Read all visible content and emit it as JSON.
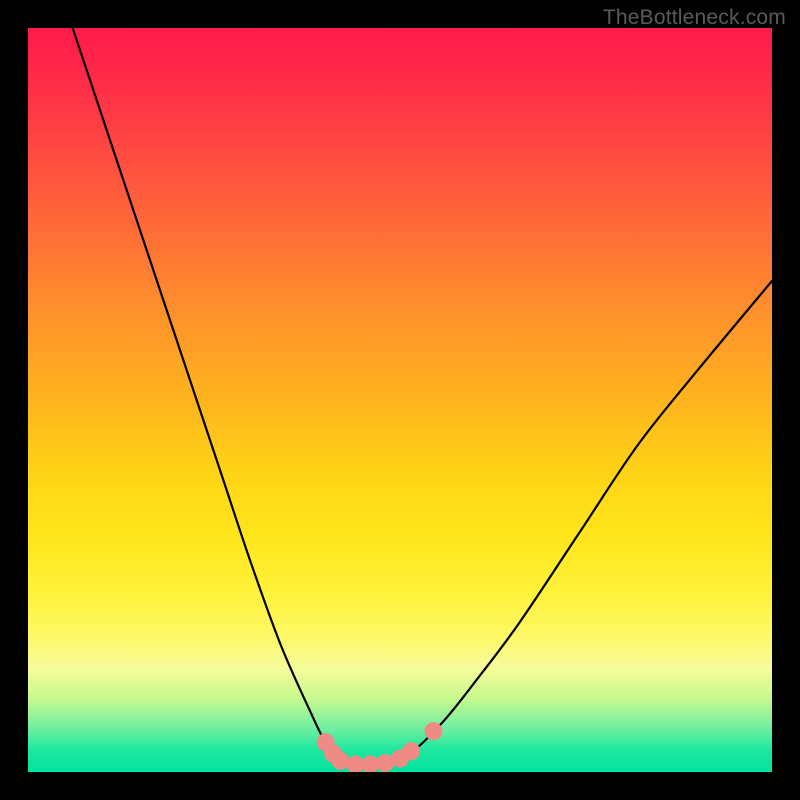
{
  "watermark": "TheBottleneck.com",
  "chart_data": {
    "type": "line",
    "title": "",
    "xlabel": "",
    "ylabel": "",
    "xlim": [
      0,
      100
    ],
    "ylim": [
      0,
      100
    ],
    "grid": false,
    "legend": false,
    "series": [
      {
        "name": "bottleneck-curve",
        "x": [
          6,
          10,
          14,
          18,
          22,
          26,
          30,
          34,
          38,
          40,
          42,
          44,
          46,
          48,
          50,
          52,
          56,
          60,
          66,
          74,
          82,
          90,
          100
        ],
        "y": [
          100,
          88,
          76,
          64,
          52,
          40,
          28,
          17,
          8,
          4,
          2,
          1,
          1,
          1,
          2,
          3,
          7,
          12,
          20,
          32,
          44,
          54,
          66
        ]
      }
    ],
    "markers": [
      {
        "name": "marker-left-top",
        "x": 40.0,
        "y": 4.0
      },
      {
        "name": "marker-left-mid",
        "x": 41.0,
        "y": 2.5
      },
      {
        "name": "marker-left-bot",
        "x": 42.0,
        "y": 1.5
      },
      {
        "name": "marker-flat-1",
        "x": 44.0,
        "y": 1.0
      },
      {
        "name": "marker-flat-2",
        "x": 46.0,
        "y": 1.0
      },
      {
        "name": "marker-flat-3",
        "x": 48.0,
        "y": 1.2
      },
      {
        "name": "marker-flat-4",
        "x": 50.0,
        "y": 1.8
      },
      {
        "name": "marker-right-mid",
        "x": 51.5,
        "y": 2.8
      },
      {
        "name": "marker-right-gap",
        "x": 54.5,
        "y": 5.5
      }
    ],
    "marker_color": "#ef8a84",
    "curve_color": "#000000"
  }
}
